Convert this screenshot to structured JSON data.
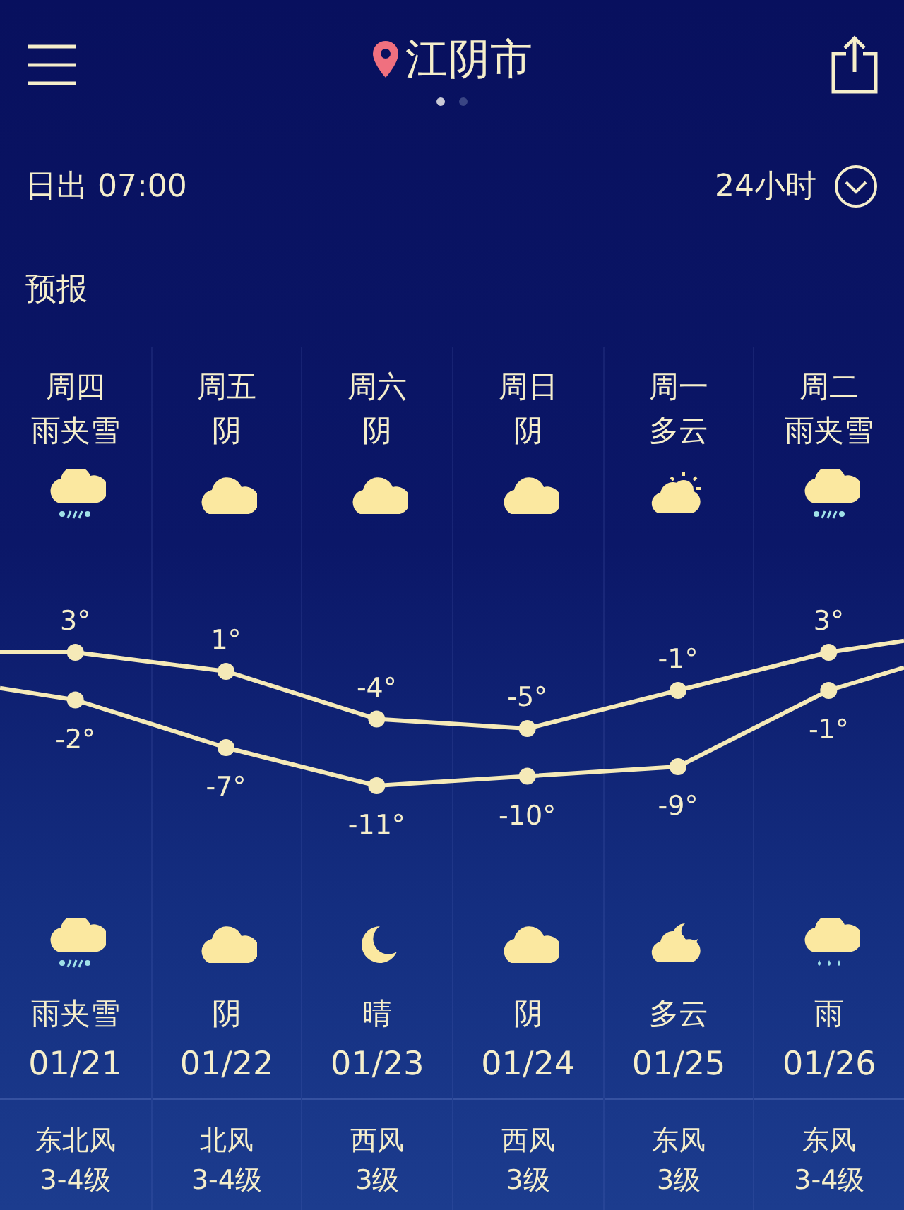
{
  "header": {
    "city": "江阴市",
    "pages": [
      {
        "selected": true
      },
      {
        "selected": false
      }
    ]
  },
  "sunrise": {
    "label": "日出",
    "time": "07:00"
  },
  "range_toggle": {
    "label": "24小时"
  },
  "section_title": "预报",
  "days": [
    {
      "weekday": "周四",
      "day_condition": "雨夹雪",
      "day_icon": {
        "kind": "sleet"
      },
      "night_icon": {
        "kind": "sleet"
      },
      "night_condition": "雨夹雪",
      "date": "01/21",
      "wind": "东北风",
      "wind_level": "3-4级"
    },
    {
      "weekday": "周五",
      "day_condition": "阴",
      "day_icon": {
        "kind": "cloudy"
      },
      "night_icon": {
        "kind": "cloudy"
      },
      "night_condition": "阴",
      "date": "01/22",
      "wind": "北风",
      "wind_level": "3-4级"
    },
    {
      "weekday": "周六",
      "day_condition": "阴",
      "day_icon": {
        "kind": "cloudy"
      },
      "night_icon": {
        "kind": "moon"
      },
      "night_condition": "晴",
      "date": "01/23",
      "wind": "西风",
      "wind_level": "3级"
    },
    {
      "weekday": "周日",
      "day_condition": "阴",
      "day_icon": {
        "kind": "cloudy"
      },
      "night_icon": {
        "kind": "cloudy"
      },
      "night_condition": "阴",
      "date": "01/24",
      "wind": "西风",
      "wind_level": "3级"
    },
    {
      "weekday": "周一",
      "day_condition": "多云",
      "day_icon": {
        "kind": "suncloud"
      },
      "night_icon": {
        "kind": "mooncloud"
      },
      "night_condition": "多云",
      "date": "01/25",
      "wind": "东风",
      "wind_level": "3级"
    },
    {
      "weekday": "周二",
      "day_condition": "雨夹雪",
      "day_icon": {
        "kind": "sleet"
      },
      "night_icon": {
        "kind": "rain"
      },
      "night_condition": "雨",
      "date": "01/26",
      "wind": "东风",
      "wind_level": "3-4级"
    }
  ],
  "chart_data": {
    "type": "line",
    "series": [
      {
        "color": "#f5eab8",
        "marker": "circle",
        "values": [
          3,
          1,
          -4,
          -5,
          -1,
          3
        ],
        "value_labels": [
          "3°",
          "1°",
          "-4°",
          "-5°",
          "-1°",
          "3°"
        ]
      },
      {
        "color": "#f5eab8",
        "marker": "circle",
        "values": [
          -2,
          -7,
          -11,
          -10,
          -9,
          -1
        ],
        "value_labels": [
          "-2°",
          "-7°",
          "-11°",
          "-10°",
          "-9°",
          "-1°"
        ]
      }
    ]
  }
}
